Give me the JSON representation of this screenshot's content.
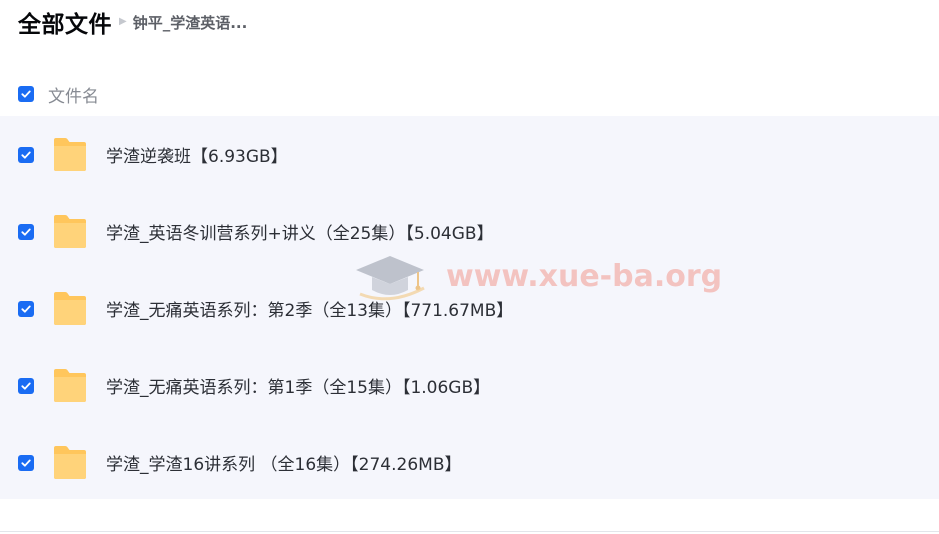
{
  "header": {
    "title": "全部文件",
    "breadcrumb": "钟平_学渣英语..."
  },
  "column_header": {
    "label": "文件名"
  },
  "files": [
    {
      "name": "学渣逆袭班【6.93GB】",
      "icon": "folder-icon"
    },
    {
      "name": "学渣_英语冬训营系列+讲义（全25集）【5.04GB】",
      "icon": "folder-icon"
    },
    {
      "name": "学渣_无痛英语系列：第2季（全13集）【771.67MB】",
      "icon": "folder-icon"
    },
    {
      "name": "学渣_无痛英语系列：第1季（全15集）【1.06GB】",
      "icon": "folder-icon"
    },
    {
      "name": "学渣_学渣16讲系列 （全16集）【274.26MB】",
      "icon": "folder-icon"
    }
  ],
  "watermark": {
    "text": "www.xue-ba.org",
    "icon": "graduation-cap-icon"
  },
  "colors": {
    "checkbox": "#1a6cf3",
    "folder": "#ffc65c",
    "list_background": "#f5f6fc",
    "watermark": "#f29a90"
  }
}
